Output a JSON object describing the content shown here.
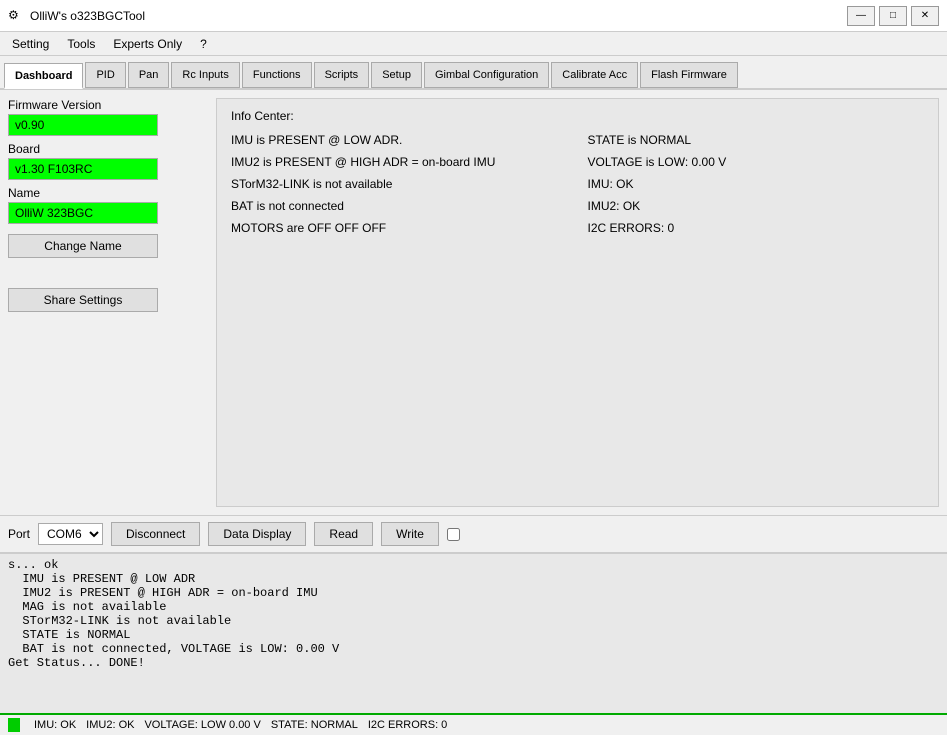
{
  "titlebar": {
    "icon": "⚙",
    "title": "OlliW's o323BGCTool",
    "minimize": "—",
    "restore": "□",
    "close": "✕"
  },
  "menubar": {
    "items": [
      {
        "label": "Setting"
      },
      {
        "label": "Tools"
      },
      {
        "label": "Experts Only"
      },
      {
        "label": "?"
      }
    ]
  },
  "tabs": [
    {
      "label": "Dashboard",
      "active": true
    },
    {
      "label": "PID"
    },
    {
      "label": "Pan"
    },
    {
      "label": "Rc Inputs"
    },
    {
      "label": "Functions"
    },
    {
      "label": "Scripts"
    },
    {
      "label": "Setup"
    },
    {
      "label": "Gimbal Configuration"
    },
    {
      "label": "Calibrate Acc"
    },
    {
      "label": "Flash Firmware"
    }
  ],
  "left_panel": {
    "firmware_label": "Firmware Version",
    "firmware_value": "v0.90",
    "board_label": "Board",
    "board_value": "v1.30 F103RC",
    "name_label": "Name",
    "name_value": "OlliW 323BGC",
    "change_name_btn": "Change Name",
    "share_settings_btn": "Share Settings"
  },
  "info_panel": {
    "title": "Info Center:",
    "items": [
      {
        "text": "IMU is PRESENT @ LOW ADR.",
        "col": 1
      },
      {
        "text": "STATE is NORMAL",
        "col": 2
      },
      {
        "text": "IMU2 is PRESENT @ HIGH ADR = on-board IMU",
        "col": 1
      },
      {
        "text": "VOLTAGE is LOW: 0.00 V",
        "col": 2
      },
      {
        "text": "STorM32-LINK is not available",
        "col": 1
      },
      {
        "text": "IMU: OK",
        "col": 2
      },
      {
        "text": "BAT is not connected",
        "col": 1
      },
      {
        "text": "IMU2: OK",
        "col": 2
      },
      {
        "text": "MOTORS are OFF OFF OFF",
        "col": 1
      },
      {
        "text": "I2C ERRORS: 0",
        "col": 2
      }
    ]
  },
  "controls_bar": {
    "port_label": "Port",
    "port_value": "COM6",
    "disconnect_btn": "Disconnect",
    "data_display_btn": "Data Display",
    "read_btn": "Read",
    "write_btn": "Write"
  },
  "console": {
    "lines": [
      "s... ok",
      "  IMU is PRESENT @ LOW ADR",
      "  IMU2 is PRESENT @ HIGH ADR = on-board IMU",
      "  MAG is not available",
      "  STorM32-LINK is not available",
      "  STATE is NORMAL",
      "  BAT is not connected, VOLTAGE is LOW: 0.00 V",
      "Get Status... DONE!"
    ]
  },
  "status_line": {
    "imu": "IMU: OK",
    "imu2": "IMU2: OK",
    "voltage": "VOLTAGE: LOW 0.00 V",
    "state": "STATE: NORMAL",
    "i2c": "I2C ERRORS: 0"
  }
}
